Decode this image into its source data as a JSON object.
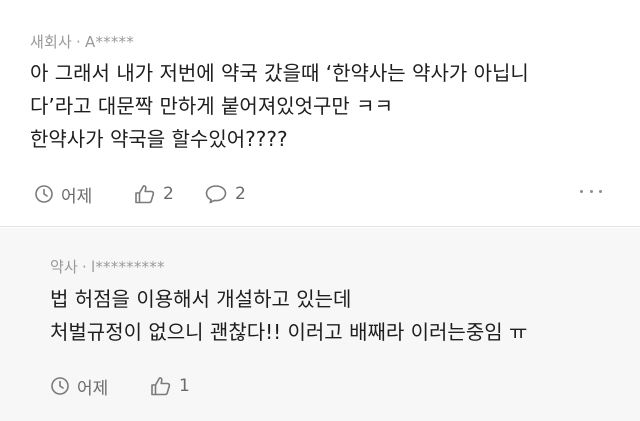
{
  "comments": [
    {
      "author": "새회사",
      "separator": "·",
      "nickname": "A*****",
      "body_lines": [
        "아 그래서 내가 저번에 약국 갔을때 ‘한약사는 약사가 아닙니",
        "다’라고 대문짝 만하게 붙어져있엇구만 ㅋㅋ",
        "한약사가 약국을 할수있어????"
      ],
      "time": "어제",
      "likes": "2",
      "replies": "2",
      "icons": {
        "time": "clock-icon",
        "like": "thumbs-up-icon",
        "reply": "speech-bubble-icon",
        "more": "more-dots-icon"
      }
    }
  ],
  "reply": {
    "author": "약사",
    "separator": "·",
    "nickname": "l*********",
    "body_lines": [
      "법 허점을 이용해서 개설하고 있는데",
      "처벌규정이 없으니 괜찮다!! 이러고 배째라 이러는중임 ㅠ"
    ],
    "time": "어제",
    "likes": "1",
    "icons": {
      "time": "clock-icon",
      "like": "thumbs-up-icon"
    }
  },
  "colors": {
    "meta": "#9a9a9a",
    "body": "#1e1e1e",
    "action": "#6b6b6b",
    "reply_background": "#f7f7f7",
    "divider": "#e3e3e3"
  }
}
